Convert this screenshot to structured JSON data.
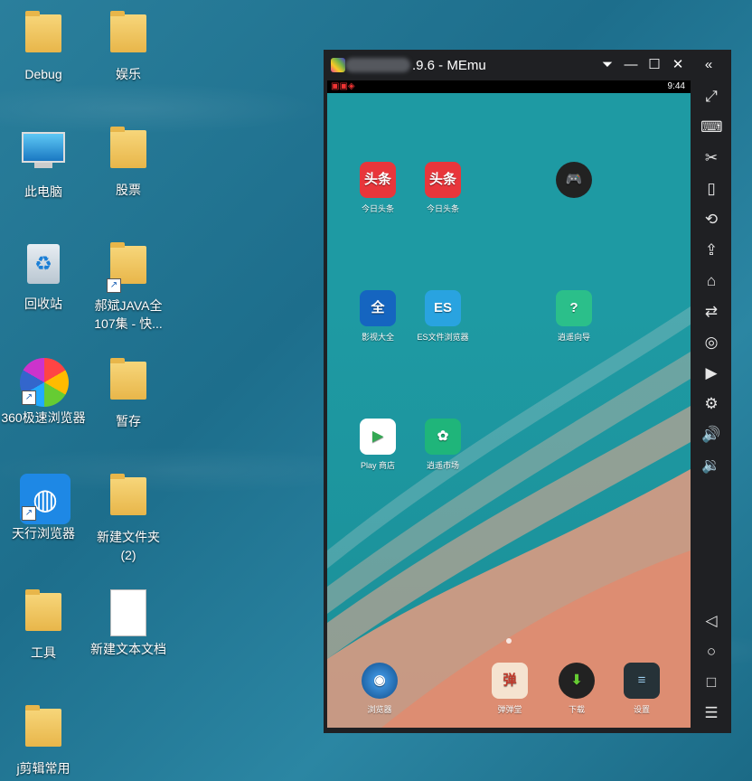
{
  "desktop": {
    "icons": [
      {
        "label": "Debug",
        "icon": "folder-icon"
      },
      {
        "label": "娱乐",
        "icon": "qq-penguin-icon"
      },
      {
        "label": "此电脑",
        "icon": "computer-icon"
      },
      {
        "label": "股票",
        "icon": "folder-icon"
      },
      {
        "label": "回收站",
        "icon": "recycle-bin-icon"
      },
      {
        "label": "郝斌JAVA全107集 - 快...",
        "icon": "folder-icon"
      },
      {
        "label": "360极速浏览器",
        "icon": "360-browser-icon"
      },
      {
        "label": "暂存",
        "icon": "folder-icon"
      },
      {
        "label": "天行浏览器",
        "icon": "globe-lock-icon"
      },
      {
        "label": "新建文件夹 (2)",
        "icon": "folder-icon"
      },
      {
        "label": "工具",
        "icon": "folder-icon"
      },
      {
        "label": "新建文本文档",
        "icon": "text-document-icon"
      },
      {
        "label": "j剪辑常用",
        "icon": "folder-icon"
      }
    ]
  },
  "emulator": {
    "title": ".9.6 - MEmu",
    "status_time": "9:44",
    "apps": [
      {
        "label": "今日头条",
        "glyph": "头条",
        "bg": "#e8363b"
      },
      {
        "label": "今日头条",
        "glyph": "头条",
        "bg": "#e8363b"
      },
      {
        "label": "影视大全",
        "glyph": "全",
        "bg": "#1565c0"
      },
      {
        "label": "ES文件浏览器",
        "glyph": "ES",
        "bg": "#29a3e0"
      },
      {
        "label": "逍遥向导",
        "glyph": "?",
        "bg": "#2bbf8a"
      },
      {
        "label": "Play 商店",
        "glyph": "▶",
        "bg": "#ffffff"
      },
      {
        "label": "逍遥市场",
        "glyph": "✿",
        "bg": "#1fb57a"
      }
    ],
    "dock": [
      {
        "label": "浏览器",
        "glyph": "◉"
      },
      {
        "label": "弹弹堂",
        "glyph": "弹"
      },
      {
        "label": "下载",
        "glyph": "⬇"
      },
      {
        "label": "设置",
        "glyph": "≡"
      }
    ],
    "sidebar_buttons": [
      "expand-icon",
      "keyboard-icon",
      "scissors-icon",
      "shake-icon",
      "rotate-icon",
      "apk-icon",
      "broom-icon",
      "share-icon",
      "mouse-icon",
      "record-icon",
      "settings-icon",
      "volume-up-icon",
      "volume-down-icon",
      "back-icon",
      "home-icon",
      "recents-icon",
      "menu-icon"
    ],
    "sidebar_glyphs": [
      "⤢",
      "⌨",
      "✂",
      "▯",
      "⟲",
      "⇪",
      "⌂",
      "⇄",
      "◎",
      "▶",
      "⚙",
      "🔊",
      "🔉",
      "◁",
      "○",
      "□",
      "☰"
    ]
  }
}
